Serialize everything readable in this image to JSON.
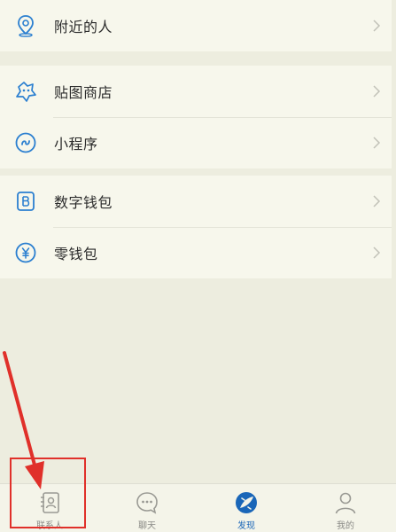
{
  "menu": {
    "group1": [
      {
        "label": "附近的人",
        "icon": "location-pin-icon"
      }
    ],
    "group2": [
      {
        "label": "贴图商店",
        "icon": "sticker-icon"
      },
      {
        "label": "小程序",
        "icon": "mini-program-icon"
      }
    ],
    "group3": [
      {
        "label": "数字钱包",
        "icon": "digital-wallet-icon"
      },
      {
        "label": "零钱包",
        "icon": "coin-purse-icon"
      }
    ]
  },
  "tabbar": {
    "tabs": [
      {
        "label": "联系人",
        "icon": "contacts-icon",
        "active": false
      },
      {
        "label": "聊天",
        "icon": "chat-icon",
        "active": false
      },
      {
        "label": "发现",
        "icon": "discover-icon",
        "active": true
      },
      {
        "label": "我的",
        "icon": "profile-icon",
        "active": false
      }
    ]
  },
  "colors": {
    "accent": "#1a66b8",
    "icon_blue": "#2b7fd0",
    "annotation_red": "#e0302a",
    "background": "#ededdf",
    "card": "#f7f7ec"
  }
}
